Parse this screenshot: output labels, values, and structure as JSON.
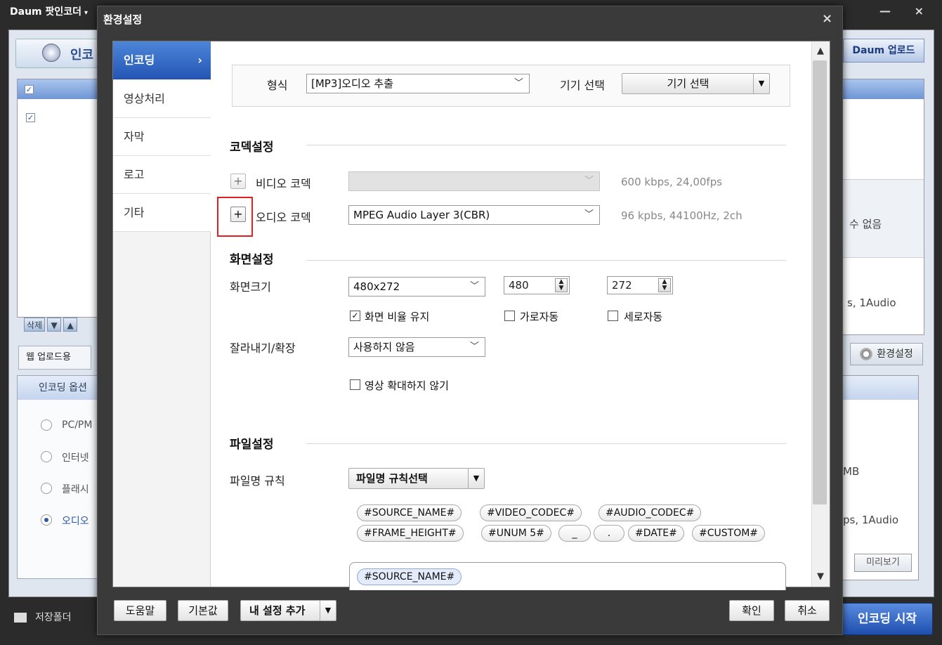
{
  "app": {
    "title": "Daum 팟인코더",
    "title_arrow": "▾",
    "win_controls": "— ×",
    "header_label": "인코",
    "list_tools": [
      "삭제",
      "▼",
      "▲"
    ],
    "tab_web": "웹 업로드용",
    "options_head": "인코딩 옵션",
    "radios": [
      {
        "label": "PC/PM",
        "selected": false
      },
      {
        "label": "인터넷",
        "selected": false
      },
      {
        "label": "플래시",
        "selected": false
      },
      {
        "label": "오디오",
        "selected": true
      }
    ],
    "save_folder": "저장폴더",
    "upload_button": "Daum 업로드",
    "right_text_1": "수 없음",
    "right_text_2": "s, 1Audio",
    "right_text_3": "MB",
    "right_text_4": "ps, 1Audio",
    "env_button": "환경설정",
    "preview_button": "미리보기",
    "start_button": "인코딩 시작"
  },
  "dialog": {
    "title": "환경설정",
    "close": "×",
    "nav": [
      {
        "label": "인코딩",
        "active": true
      },
      {
        "label": "영상처리",
        "active": false
      },
      {
        "label": "자막",
        "active": false
      },
      {
        "label": "로고",
        "active": false
      },
      {
        "label": "기타",
        "active": false
      }
    ],
    "nav_chevron": "›",
    "format_label": "형식",
    "format_value": "[MP3]오디오 추출",
    "device_label": "기기 선택",
    "device_button": "기기 선택",
    "codec_section": "코덱설정",
    "video_codec_label": "비디오 코덱",
    "video_codec_value": "",
    "video_codec_info": "600 kbps, 24,00fps",
    "audio_codec_label": "오디오 코덱",
    "audio_codec_value": "MPEG Audio Layer 3(CBR)",
    "audio_codec_info": "96 kpbs, 44100Hz, 2ch",
    "screen_section": "화면설정",
    "screen_size_label": "화면크기",
    "screen_size_value": "480x272",
    "width_value": "480",
    "height_value": "272",
    "keep_ratio": {
      "label": "화면 비율 유지",
      "checked": true
    },
    "auto_width": {
      "label": "가로자동",
      "checked": false
    },
    "auto_height": {
      "label": "세로자동",
      "checked": false
    },
    "crop_label": "잘라내기/확장",
    "crop_value": "사용하지 않음",
    "no_upscale": {
      "label": "영상 확대하지 않기",
      "checked": false
    },
    "file_section": "파일설정",
    "filename_rule_label": "파일명 규칙",
    "filename_rule_button": "파일명 규칙선택",
    "tags_row1": [
      "#SOURCE_NAME#",
      "#VIDEO_CODEC#",
      "#AUDIO_CODEC#"
    ],
    "tags_row2": [
      "#FRAME_HEIGHT#",
      "#UNUM 5#",
      "_",
      ".",
      "#DATE#",
      "#CUSTOM#"
    ],
    "filename_tag": "#SOURCE_NAME#",
    "help_button": "도움말",
    "default_button": "기본값",
    "add_setting_button": "내 설정 추가",
    "ok_button": "확인",
    "cancel_button": "취소"
  }
}
